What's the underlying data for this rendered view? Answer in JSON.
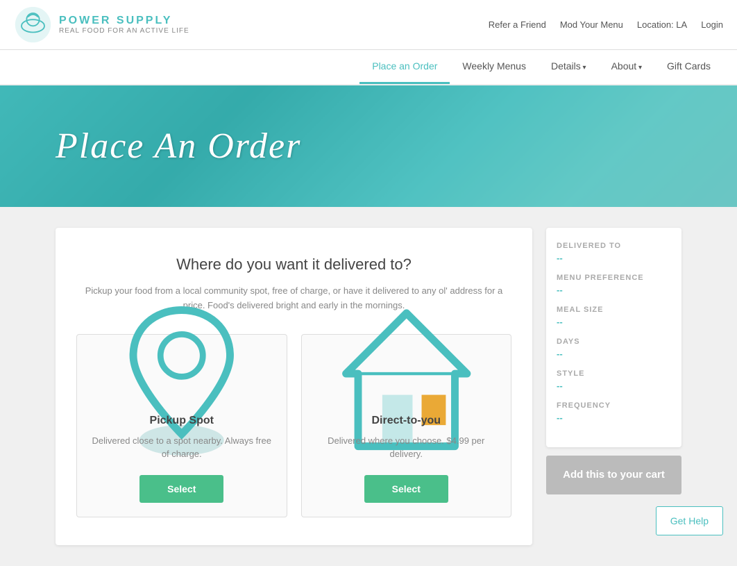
{
  "topBar": {
    "referLink": "Refer a Friend",
    "modMenuLink": "Mod Your Menu",
    "locationLink": "Location: LA",
    "loginLink": "Login"
  },
  "logo": {
    "name": "POWER SUPPLY",
    "tagline": "REAL FOOD FOR AN ACTIVE LIFE"
  },
  "mainNav": {
    "items": [
      {
        "label": "Place an Order",
        "active": true,
        "hasArrow": false
      },
      {
        "label": "Weekly Menus",
        "active": false,
        "hasArrow": false
      },
      {
        "label": "Details",
        "active": false,
        "hasArrow": true
      },
      {
        "label": "About",
        "active": false,
        "hasArrow": true
      },
      {
        "label": "Gift Cards",
        "active": false,
        "hasArrow": false
      }
    ]
  },
  "hero": {
    "title": "Place an Order"
  },
  "mainContent": {
    "heading": "Where do you want it delivered to?",
    "subtitle": "Pickup your food from a local community spot, free of charge, or have it delivered to any ol' address for a price. Food's delivered bright and early in the mornings.",
    "options": [
      {
        "id": "pickup",
        "title": "Pickup Spot",
        "description": "Delivered close to a spot nearby. Always free of charge.",
        "selectLabel": "Select"
      },
      {
        "id": "direct",
        "title": "Direct-to-you",
        "description": "Delivered where you choose. $4.99 per delivery.",
        "selectLabel": "Select"
      }
    ]
  },
  "orderSummary": {
    "rows": [
      {
        "label": "DELIVERED TO",
        "value": "--"
      },
      {
        "label": "MENU PREFERENCE",
        "value": "--"
      },
      {
        "label": "MEAL SIZE",
        "value": "--"
      },
      {
        "label": "DAYS",
        "value": "--"
      },
      {
        "label": "STYLE",
        "value": "--"
      },
      {
        "label": "FREQUENCY",
        "value": "--"
      }
    ],
    "addToCartLabel": "Add this to your cart"
  },
  "getHelp": {
    "label": "Get Help"
  }
}
